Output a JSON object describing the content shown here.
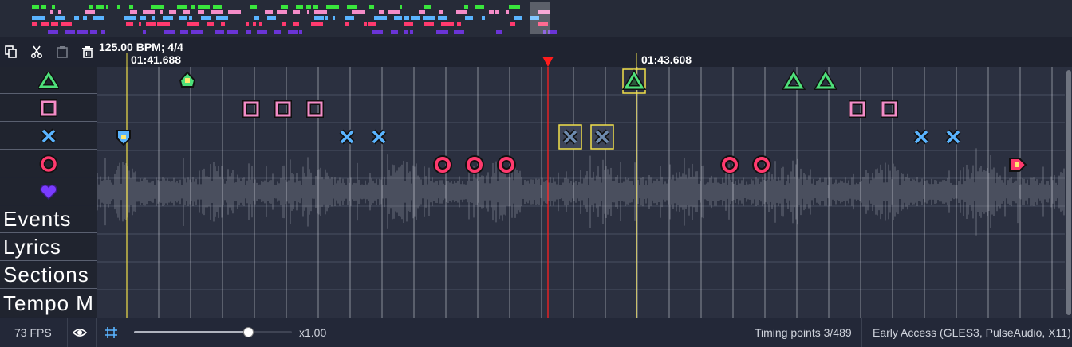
{
  "toolbar": {
    "bpm": "125.00 BPM; 4/4",
    "buttons": [
      "copy-icon",
      "cut-icon",
      "paste-icon",
      "delete-icon"
    ]
  },
  "timeline": {
    "left_time": "01:41.688",
    "marker_time": "01:43.608"
  },
  "lanes": {
    "note_types": [
      "triangle",
      "square",
      "cross",
      "circle",
      "heart"
    ],
    "text_lanes": [
      "Events",
      "Lyrics",
      "Sections",
      "Tempo M"
    ]
  },
  "colors": {
    "triangle": "#4ee07a",
    "square": "#f48cc8",
    "cross": "#5ab4ff",
    "circle": "#ff3a6e",
    "heart": "#7a3cff",
    "playhead": "#ff2020",
    "timing": "#f2e04a"
  },
  "status": {
    "fps": "73 FPS",
    "zoom": "x1.00",
    "zoom_level": 0.72,
    "timing_points": "Timing points 3/489",
    "build": "Early Access (GLES3, PulseAudio, X11)"
  }
}
